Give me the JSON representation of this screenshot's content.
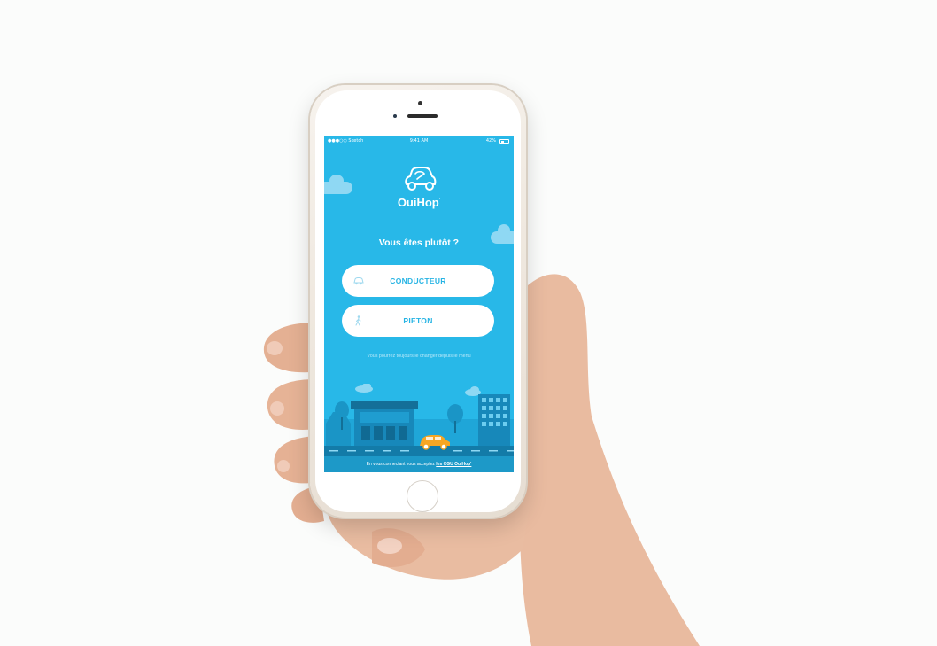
{
  "status_bar": {
    "carrier": "●●●○○ Sketch",
    "time": "9:41 AM",
    "battery": "42%",
    "battery_level": 0.42
  },
  "app": {
    "name": "OuiHop",
    "trademark": "'",
    "logo_icon": "car-logo-icon"
  },
  "onboarding": {
    "question": "Vous êtes plutôt ?",
    "options": [
      {
        "label": "CONDUCTEUR",
        "icon": "car-icon"
      },
      {
        "label": "PIETON",
        "icon": "walking-person-icon"
      }
    ],
    "hint": "Vous pourrez toujours le changer depuis le menu"
  },
  "footer": {
    "text": "En vous connectant vous acceptez",
    "link": "les CGU OuiHop'"
  },
  "colors": {
    "primary": "#28b8e8",
    "footer_bg": "#1d99c8",
    "button_bg": "#ffffff",
    "button_text": "#27b4e4",
    "car_accent": "#f6a623"
  }
}
